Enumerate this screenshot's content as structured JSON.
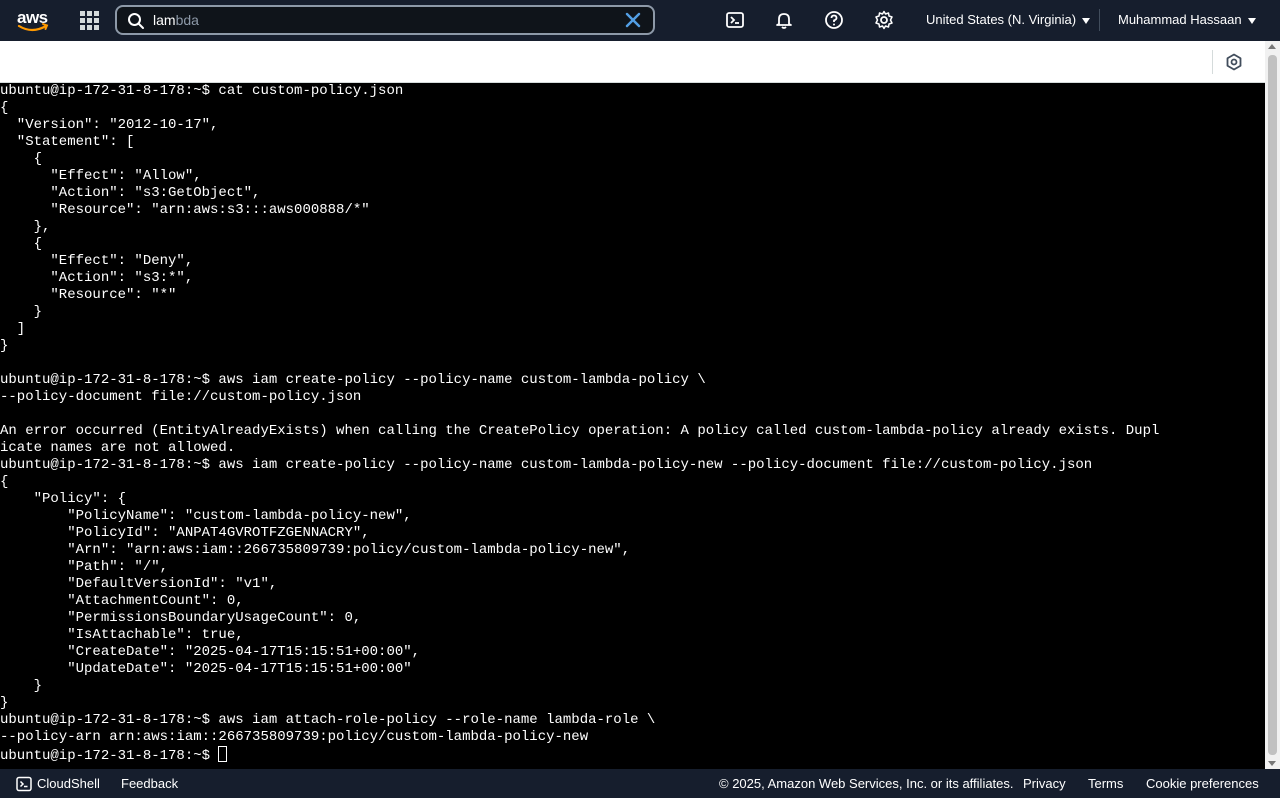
{
  "nav": {
    "logo_text": "aws",
    "search_value": "lam",
    "search_ghost": "bda",
    "region": "United States (N. Virginia)",
    "user": "Muhammad Hassaan",
    "icons": [
      "cloudshell-icon",
      "bell-icon",
      "help-icon",
      "gear-icon"
    ]
  },
  "terminal": {
    "lines": [
      "ubuntu@ip-172-31-8-178:~$ cat custom-policy.json",
      "{",
      "  \"Version\": \"2012-10-17\",",
      "  \"Statement\": [",
      "    {",
      "      \"Effect\": \"Allow\",",
      "      \"Action\": \"s3:GetObject\",",
      "      \"Resource\": \"arn:aws:s3:::aws000888/*\"",
      "    },",
      "    {",
      "      \"Effect\": \"Deny\",",
      "      \"Action\": \"s3:*\",",
      "      \"Resource\": \"*\"",
      "    }",
      "  ]",
      "}",
      "",
      "ubuntu@ip-172-31-8-178:~$ aws iam create-policy --policy-name custom-lambda-policy \\",
      "--policy-document file://custom-policy.json",
      "",
      "An error occurred (EntityAlreadyExists) when calling the CreatePolicy operation: A policy called custom-lambda-policy already exists. Dupl",
      "icate names are not allowed.",
      "ubuntu@ip-172-31-8-178:~$ aws iam create-policy --policy-name custom-lambda-policy-new --policy-document file://custom-policy.json",
      "{",
      "    \"Policy\": {",
      "        \"PolicyName\": \"custom-lambda-policy-new\",",
      "        \"PolicyId\": \"ANPAT4GVROTFZGENNACRY\",",
      "        \"Arn\": \"arn:aws:iam::266735809739:policy/custom-lambda-policy-new\",",
      "        \"Path\": \"/\",",
      "        \"DefaultVersionId\": \"v1\",",
      "        \"AttachmentCount\": 0,",
      "        \"PermissionsBoundaryUsageCount\": 0,",
      "        \"IsAttachable\": true,",
      "        \"CreateDate\": \"2025-04-17T15:15:51+00:00\",",
      "        \"UpdateDate\": \"2025-04-17T15:15:51+00:00\"",
      "    }",
      "}",
      "ubuntu@ip-172-31-8-178:~$ aws iam attach-role-policy --role-name lambda-role \\",
      "--policy-arn arn:aws:iam::266735809739:policy/custom-lambda-policy-new"
    ],
    "prompt": "ubuntu@ip-172-31-8-178:~$ "
  },
  "footer": {
    "cloudshell": "CloudShell",
    "feedback": "Feedback",
    "copyright": "© 2025, Amazon Web Services, Inc. or its affiliates.",
    "privacy": "Privacy",
    "terms": "Terms",
    "cookie": "Cookie preferences"
  }
}
